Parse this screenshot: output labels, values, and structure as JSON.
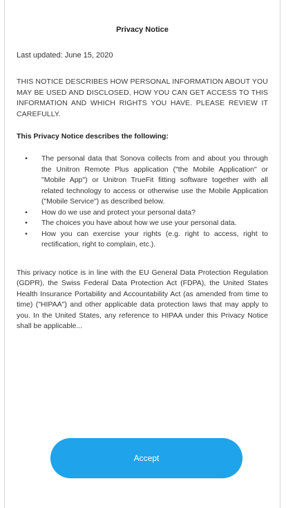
{
  "notice": {
    "title": "Privacy Notice",
    "last_updated": "Last updated: June 15, 2020",
    "caps_intro": "THIS NOTICE DESCRIBES HOW PERSONAL INFORMATION ABOUT YOU MAY BE USED AND DISCLOSED, HOW YOU CAN GET ACCESS TO THIS INFORMATION AND WHICH RIGHTS YOU HAVE. PLEASE REVIEW IT CAREFULLY.",
    "describes_heading": "This Privacy Notice describes the following:",
    "bullet_char": "•",
    "items": [
      "The personal data that Sonova collects from and about you through the Unitron Remote Plus application (\"the Mobile Application\" or \"Mobile App\") or Unitron TrueFit fitting software together with all related technology to access or otherwise use the Mobile Application (\"Mobile Service\") as described below.",
      "How do we use and protect your personal data?",
      "The choices you have about how we use your personal data.",
      "How you can exercise your rights (e.g. right to access, right to rectification, right to complain, etc.)."
    ],
    "paragraph": "This privacy notice is in line with the EU General Data Protection Regulation (GDPR), the Swiss Federal Data Protection Act (FDPA), the United States Health Insurance Portability and Accountability Act (as amended from time to time) (\"HIPAA\") and other applicable data protection laws that may apply to you. In the United States, any reference to HIPAA under this Privacy Notice shall be applicable..."
  },
  "actions": {
    "accept_label": "Accept"
  },
  "colors": {
    "accent": "#1fa3ea",
    "background": "#ffffff"
  }
}
